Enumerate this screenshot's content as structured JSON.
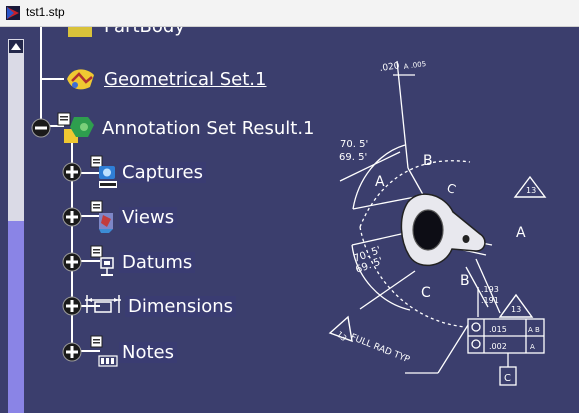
{
  "window": {
    "title": "tst1.stp"
  },
  "tree": {
    "partbody_label": "PartBody",
    "geometrical_set_label": "Geometrical Set.1",
    "annotation_set_label": "Annotation Set Result.1",
    "children": [
      {
        "label": "Captures",
        "icon": "captures-icon"
      },
      {
        "label": "Views",
        "icon": "views-icon"
      },
      {
        "label": "Datums",
        "icon": "datums-icon"
      },
      {
        "label": "Dimensions",
        "icon": "dimensions-icon"
      },
      {
        "label": "Notes",
        "icon": "notes-icon"
      }
    ]
  },
  "drawing": {
    "tolerance_top": ".020",
    "tolerance_top_suffix": "A .005",
    "angle_upper_1": "70. 5'",
    "angle_upper_2": "69. 5'",
    "angle_lower_1": "70. 5'",
    "angle_lower_2": "69. 5'",
    "label_a_left": "A",
    "label_b_upper": "B",
    "label_c_upper": "C",
    "label_a_right": "A",
    "label_c_lower": "C",
    "label_b_lower": "B",
    "note_13_top": "13",
    "note_13_mid": "13",
    "note_13_left": "13",
    "full_rad_note": "FULL RAD TYP",
    "dim_193": ".193",
    "dim_191": ".191",
    "fcf_1": ".015",
    "fcf_1_ref": "A B",
    "fcf_2": ".002",
    "fcf_2_ref": "A",
    "datum_c": "C"
  },
  "colors": {
    "background": "#3b3e6d",
    "tree_text": "#ffffff",
    "scroll_thumb": "#8a84e6"
  }
}
